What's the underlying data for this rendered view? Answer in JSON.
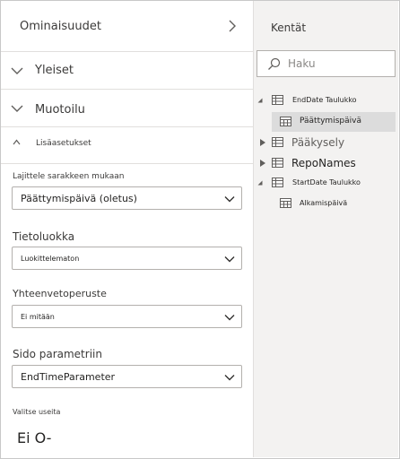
{
  "properties_pane": {
    "title": "Ominaisuudet",
    "sections": [
      {
        "label": "Yleiset"
      },
      {
        "label": "Muotoilu"
      },
      {
        "label": "Lisäasetukset"
      }
    ],
    "sort_by": {
      "label": "Lajittele sarakkeen mukaan",
      "value": "Päättymispäivä (oletus)"
    },
    "data_category": {
      "label": "Tietoluokka",
      "value": "Luokittelematon"
    },
    "summarize_by": {
      "label": "Yhteenvetoperuste",
      "value": "Ei mitään"
    },
    "bind_parameter": {
      "label": "Sido parametriin",
      "value": "EndTimeParameter"
    },
    "multi_select": {
      "label": "Valitse useita",
      "value": "Ei O-"
    }
  },
  "fields_pane": {
    "title": "Kentät",
    "search_placeholder": "Haku",
    "items": [
      {
        "label": "EndDate Taulukko"
      },
      {
        "label": "Päättymispäivä"
      },
      {
        "label": "Pääkysely"
      },
      {
        "label": "RepoNames"
      },
      {
        "label": "StartDate Taulukko"
      },
      {
        "label": "Alkamispäivä"
      }
    ]
  },
  "colors": {
    "accent_border": "#b3b0ad",
    "selected_row": "#dcdcdc",
    "fields_bg": "#f3f2f1"
  }
}
